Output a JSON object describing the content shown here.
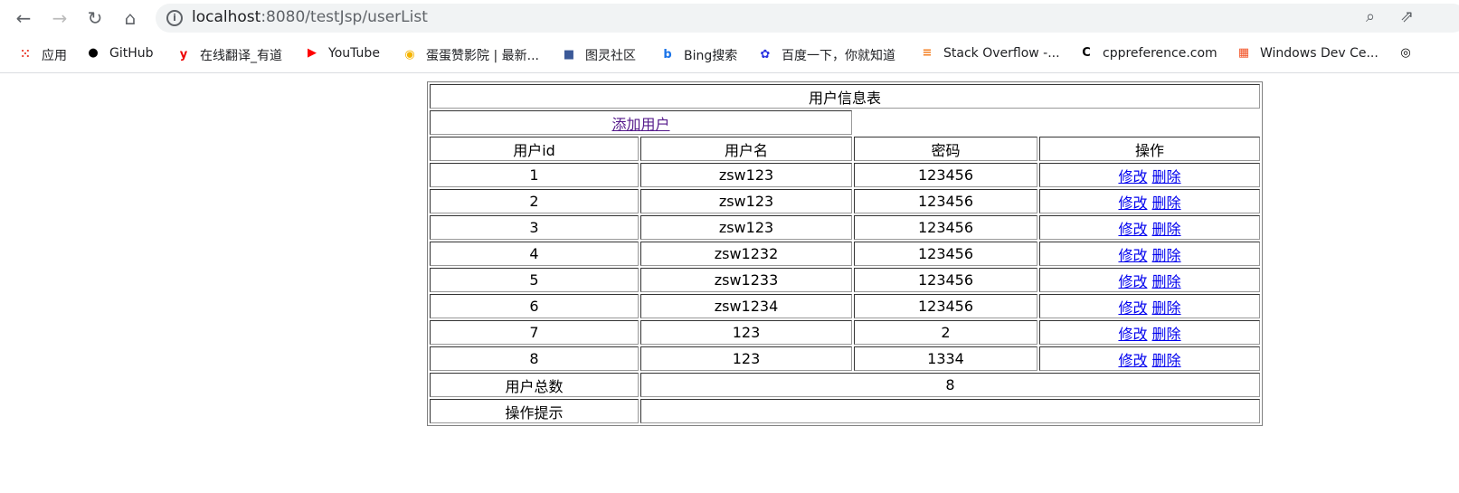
{
  "browser": {
    "url_host": "localhost",
    "url_rest": ":8080/testJsp/userList",
    "bookmarks": [
      {
        "label": "应用",
        "icon": "apps-grid-icon"
      },
      {
        "label": "GitHub",
        "icon": "github-icon"
      },
      {
        "label": "在线翻译_有道",
        "icon": "youdao-icon"
      },
      {
        "label": "YouTube",
        "icon": "youtube-icon"
      },
      {
        "label": "蛋蛋赞影院 | 最新...",
        "icon": "egg-icon"
      },
      {
        "label": "图灵社区",
        "icon": "turing-icon"
      },
      {
        "label": "Bing搜索",
        "icon": "bing-icon"
      },
      {
        "label": "百度一下，你就知道",
        "icon": "baidu-icon"
      },
      {
        "label": "Stack Overflow -...",
        "icon": "stackoverflow-icon"
      },
      {
        "label": "cppreference.com",
        "icon": "cppreference-icon"
      },
      {
        "label": "Windows Dev Ce...",
        "icon": "windows-icon"
      },
      {
        "label": "",
        "icon": "globe-icon"
      }
    ]
  },
  "table": {
    "title": "用户信息表",
    "add_link": "添加用户",
    "headers": [
      "用户id",
      "用户名",
      "密码",
      "操作"
    ],
    "rows": [
      {
        "id": "1",
        "name": "zsw123",
        "pwd": "123456"
      },
      {
        "id": "2",
        "name": "zsw123",
        "pwd": "123456"
      },
      {
        "id": "3",
        "name": "zsw123",
        "pwd": "123456"
      },
      {
        "id": "4",
        "name": "zsw1232",
        "pwd": "123456"
      },
      {
        "id": "5",
        "name": "zsw1233",
        "pwd": "123456"
      },
      {
        "id": "6",
        "name": "zsw1234",
        "pwd": "123456"
      },
      {
        "id": "7",
        "name": "123",
        "pwd": "2"
      },
      {
        "id": "8",
        "name": "123",
        "pwd": "1334"
      }
    ],
    "edit_label": "修改",
    "delete_label": "删除",
    "total_label": "用户总数",
    "total_value": "8",
    "tip_label": "操作提示",
    "tip_value": ""
  }
}
